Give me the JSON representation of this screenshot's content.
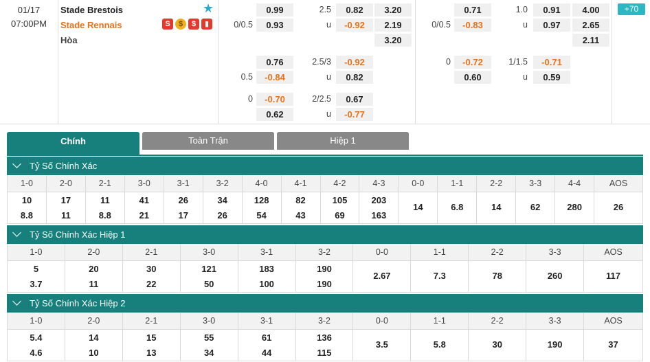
{
  "match": {
    "date": "01/17",
    "time": "07:00PM",
    "home": "Stade Brestois",
    "away": "Stade Rennais",
    "draw": "Hòa",
    "badge": "70"
  },
  "odds": {
    "ft_main": {
      "home": "0.99",
      "hc": "2.5",
      "over": "0.82",
      "h1x2": "3.20",
      "hc2": "0/0.5",
      "away": "0.93",
      "u": "u",
      "under": "-0.92",
      "a1x2": "2.19",
      "d1x2": "3.20"
    },
    "ft_alt1": {
      "home": "0.76",
      "hc": "2.5/3",
      "over": "-0.92",
      "hc2": "0.5",
      "away": "-0.84",
      "u": "u",
      "under": "0.82"
    },
    "ft_alt2": {
      "home": "-0.70",
      "hc": "2/2.5",
      "over": "0.67",
      "hc1": "0",
      "away": "0.62",
      "u": "u",
      "under": "-0.77"
    },
    "h1_main": {
      "home": "0.71",
      "hc": "1.0",
      "over": "0.91",
      "h1x2": "4.00",
      "hc2": "0/0.5",
      "away": "-0.83",
      "u": "u",
      "under": "0.97",
      "a1x2": "2.65",
      "d1x2": "2.11"
    },
    "h1_alt1": {
      "hc1": "0",
      "home": "-0.72",
      "hc": "1/1.5",
      "over": "-0.71",
      "away": "0.60",
      "u": "u",
      "under": "0.59"
    }
  },
  "tabs": [
    "Chính",
    "Toàn Trận",
    "Hiệp 1"
  ],
  "sections": [
    {
      "title": "Tỷ Số Chính Xác",
      "headers": [
        "1-0",
        "2-0",
        "2-1",
        "3-0",
        "3-1",
        "3-2",
        "4-0",
        "4-1",
        "4-2",
        "4-3",
        "0-0",
        "1-1",
        "2-2",
        "3-3",
        "4-4",
        "AOS"
      ],
      "top": [
        "10",
        "17",
        "11",
        "41",
        "26",
        "34",
        "128",
        "82",
        "105",
        "203",
        "",
        "",
        "",
        "",
        "",
        ""
      ],
      "bottom": [
        "8.8",
        "11",
        "8.8",
        "21",
        "17",
        "26",
        "54",
        "43",
        "69",
        "163",
        "",
        "",
        "",
        "",
        "",
        ""
      ],
      "mid": [
        "",
        "",
        "",
        "",
        "",
        "",
        "",
        "",
        "",
        "",
        "14",
        "6.8",
        "14",
        "62",
        "280",
        "26"
      ]
    },
    {
      "title": "Tỷ Số Chính Xác Hiệp 1",
      "headers": [
        "1-0",
        "2-0",
        "2-1",
        "3-0",
        "3-1",
        "3-2",
        "0-0",
        "1-1",
        "2-2",
        "3-3",
        "AOS"
      ],
      "top": [
        "5",
        "20",
        "30",
        "121",
        "183",
        "190",
        "",
        "",
        "",
        "",
        ""
      ],
      "bottom": [
        "3.7",
        "11",
        "22",
        "50",
        "100",
        "190",
        "",
        "",
        "",
        "",
        ""
      ],
      "mid": [
        "",
        "",
        "",
        "",
        "",
        "",
        "2.67",
        "7.3",
        "78",
        "260",
        "117"
      ]
    },
    {
      "title": "Tỷ Số Chính Xác Hiệp 2",
      "headers": [
        "1-0",
        "2-0",
        "2-1",
        "3-0",
        "3-1",
        "3-2",
        "0-0",
        "1-1",
        "2-2",
        "3-3",
        "AOS"
      ],
      "top": [
        "5.4",
        "14",
        "15",
        "55",
        "61",
        "136",
        "",
        "",
        "",
        "",
        ""
      ],
      "bottom": [
        "4.6",
        "10",
        "13",
        "34",
        "44",
        "115",
        "",
        "",
        "",
        "",
        ""
      ],
      "mid": [
        "",
        "",
        "",
        "",
        "",
        "",
        "3.5",
        "5.8",
        "30",
        "190",
        "37"
      ]
    }
  ],
  "colors": {
    "accent": "#17807c",
    "negative": "#e8711a",
    "badge": "#2cb8c2"
  }
}
